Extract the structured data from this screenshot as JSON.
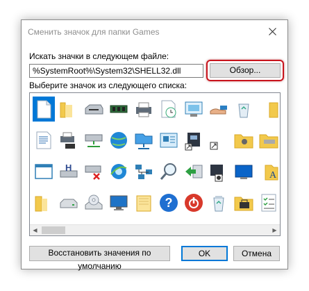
{
  "dialog": {
    "title": "Сменить значок для папки Games",
    "file_label": "Искать значки в следующем файле:",
    "file_path": "%SystemRoot%\\System32\\SHELL32.dll",
    "browse_label": "Обзор...",
    "list_label": "Выберите значок из следующего списка:",
    "restore_label": "Восстановить значения по умолчанию",
    "ok_label": "OK",
    "cancel_label": "Отмена"
  },
  "icons": [
    "blank-document-icon",
    "folder-icon",
    "floppy-drive-icon",
    "memory-chip-icon",
    "printer-icon",
    "clock-document-icon",
    "display-properties-icon",
    "sharing-hand-icon",
    "recycle-bin-icon",
    "folder-partial-icon",
    "text-document-icon",
    "printer-network-icon",
    "network-drive-icon",
    "globe-icon",
    "network-folder-icon",
    "control-panel-icon",
    "disk-shortcut-icon",
    "shortcut-arrow-icon",
    "folder-settings-icon",
    "drive-folder-icon",
    "window-icon",
    "help-disk-icon",
    "network-drive-disconnected-icon",
    "internet-explorer-icon",
    "network-computers-icon",
    "magnifier-icon",
    "green-arrow-icon",
    "moon-badge-icon",
    "blue-screen-icon",
    "font-folder-icon",
    "yellow-folder-icon",
    "hard-drive-icon",
    "cd-drive-icon",
    "monitor-icon",
    "blank-folder-icon",
    "help-icon",
    "power-icon",
    "recycle-full-icon",
    "toolbox-folder-icon",
    "checklist-icon"
  ],
  "colors": {
    "selection": "#0078d7",
    "highlight_ring": "#c8141d",
    "title_text": "#8e8e8e"
  }
}
